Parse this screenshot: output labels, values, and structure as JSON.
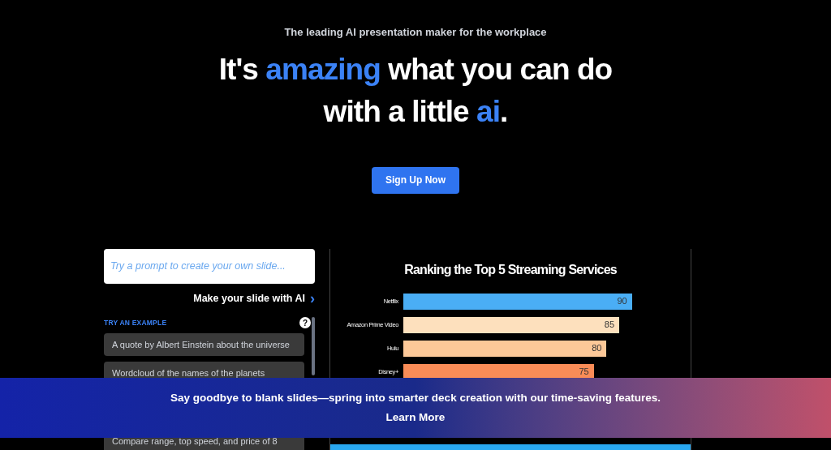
{
  "tagline": "The leading AI presentation maker for the workplace",
  "headline": {
    "line1_before": "It's",
    "highlight1": "amazing",
    "line1_after": "what you can do",
    "line2_before": "with a little",
    "highlight2": "ai",
    "line2_after": "."
  },
  "cta_button": "Sign Up Now",
  "prompt": {
    "placeholder": "Try a prompt to create your own slide...",
    "submit_link": "Make your slide with AI",
    "submit_icon": "›"
  },
  "examples": {
    "heading": "TRY AN EXAMPLE",
    "help_icon": "?",
    "items": [
      "A quote by Albert Einstein about the universe",
      "Wordcloud of the names of the planets",
      "Compare range, top speed, and price of 8"
    ]
  },
  "slide": {
    "chart_data": {
      "type": "bar",
      "orientation": "horizontal",
      "title": "Ranking the Top 5 Streaming Services",
      "categories": [
        "Netflix",
        "Amazon Prime Video",
        "Hulu",
        "Disney+"
      ],
      "values": [
        90,
        85,
        80,
        75
      ],
      "data_labels": true
    }
  },
  "banner": {
    "text": "Say goodbye to blank slides—spring into smarter deck creation with our time-saving features.",
    "link": "Learn More"
  }
}
